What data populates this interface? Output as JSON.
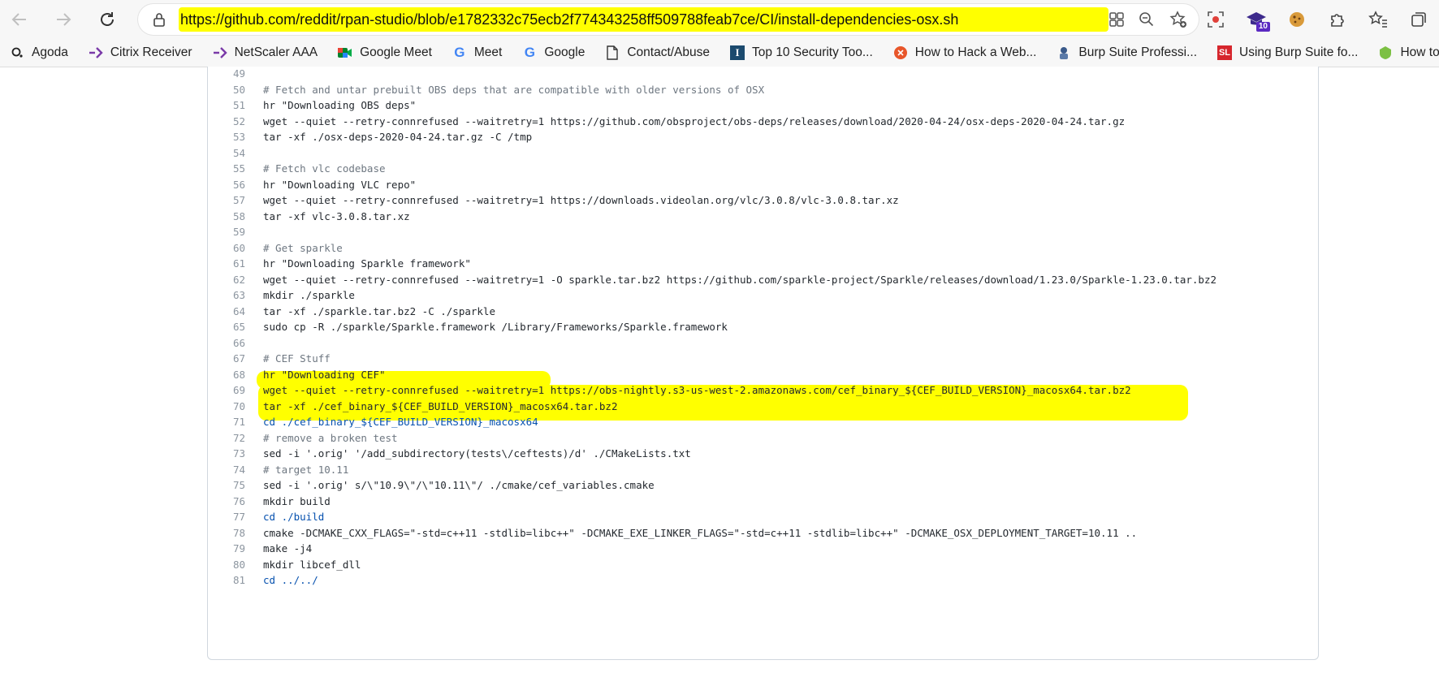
{
  "browser": {
    "url": "https://github.com/reddit/rpan-studio/blob/e1782332c75ecb2f774343258ff509788feab7ce/CI/install-dependencies-osx.sh",
    "extension_badge": "10",
    "colors": {
      "highlight": "#ffff00",
      "toolbar": "#f7f7f7"
    }
  },
  "bookmarks": [
    {
      "label": "Agoda",
      "icon": "agoda-icon"
    },
    {
      "label": "Citrix Receiver",
      "icon": "citrix-icon"
    },
    {
      "label": "NetScaler AAA",
      "icon": "netscaler-icon"
    },
    {
      "label": "Google Meet",
      "icon": "google-meet-icon"
    },
    {
      "label": "Meet",
      "icon": "google-icon"
    },
    {
      "label": "Google",
      "icon": "google-icon"
    },
    {
      "label": "Contact/Abuse",
      "icon": "document-icon"
    },
    {
      "label": "Top 10 Security Too...",
      "icon": "i-icon"
    },
    {
      "label": "How to Hack a Web...",
      "icon": "web-hack-icon"
    },
    {
      "label": "Burp Suite Professi...",
      "icon": "burp-icon"
    },
    {
      "label": "Using Burp Suite fo...",
      "icon": "sl-icon"
    },
    {
      "label": "How to Create a Pe",
      "icon": "shield-icon"
    }
  ],
  "code": {
    "lines": [
      {
        "n": "49",
        "text": "",
        "type": "plain"
      },
      {
        "n": "50",
        "text": "# Fetch and untar prebuilt OBS deps that are compatible with older versions of OSX",
        "type": "comment"
      },
      {
        "n": "51",
        "text": "hr \"Downloading OBS deps\"",
        "type": "plain"
      },
      {
        "n": "52",
        "text": "wget --quiet --retry-connrefused --waitretry=1 https://github.com/obsproject/obs-deps/releases/download/2020-04-24/osx-deps-2020-04-24.tar.gz",
        "type": "plain"
      },
      {
        "n": "53",
        "text": "tar -xf ./osx-deps-2020-04-24.tar.gz -C /tmp",
        "type": "plain"
      },
      {
        "n": "54",
        "text": "",
        "type": "plain"
      },
      {
        "n": "55",
        "text": "# Fetch vlc codebase",
        "type": "comment"
      },
      {
        "n": "56",
        "text": "hr \"Downloading VLC repo\"",
        "type": "plain"
      },
      {
        "n": "57",
        "text": "wget --quiet --retry-connrefused --waitretry=1 https://downloads.videolan.org/vlc/3.0.8/vlc-3.0.8.tar.xz",
        "type": "plain"
      },
      {
        "n": "58",
        "text": "tar -xf vlc-3.0.8.tar.xz",
        "type": "plain"
      },
      {
        "n": "59",
        "text": "",
        "type": "plain"
      },
      {
        "n": "60",
        "text": "# Get sparkle",
        "type": "comment"
      },
      {
        "n": "61",
        "text": "hr \"Downloading Sparkle framework\"",
        "type": "plain"
      },
      {
        "n": "62",
        "text": "wget --quiet --retry-connrefused --waitretry=1 -O sparkle.tar.bz2 https://github.com/sparkle-project/Sparkle/releases/download/1.23.0/Sparkle-1.23.0.tar.bz2",
        "type": "plain"
      },
      {
        "n": "63",
        "text": "mkdir ./sparkle",
        "type": "plain"
      },
      {
        "n": "64",
        "text": "tar -xf ./sparkle.tar.bz2 -C ./sparkle",
        "type": "plain"
      },
      {
        "n": "65",
        "text": "sudo cp -R ./sparkle/Sparkle.framework /Library/Frameworks/Sparkle.framework",
        "type": "plain"
      },
      {
        "n": "66",
        "text": "",
        "type": "plain"
      },
      {
        "n": "67",
        "text": "# CEF Stuff",
        "type": "comment"
      },
      {
        "n": "68",
        "text": "hr \"Downloading CEF\"",
        "type": "plain"
      },
      {
        "n": "69",
        "text": "wget --quiet --retry-connrefused --waitretry=1 https://obs-nightly.s3-us-west-2.amazonaws.com/cef_binary_${CEF_BUILD_VERSION}_macosx64.tar.bz2",
        "type": "plain"
      },
      {
        "n": "70",
        "text": "tar -xf ./cef_binary_${CEF_BUILD_VERSION}_macosx64.tar.bz2",
        "type": "plain"
      },
      {
        "n": "71",
        "text": "cd ./cef_binary_${CEF_BUILD_VERSION}_macosx64",
        "type": "kw"
      },
      {
        "n": "72",
        "text": "# remove a broken test",
        "type": "comment"
      },
      {
        "n": "73",
        "text": "sed -i '.orig' '/add_subdirectory(tests\\/ceftests)/d' ./CMakeLists.txt",
        "type": "plain"
      },
      {
        "n": "74",
        "text": "# target 10.11",
        "type": "comment"
      },
      {
        "n": "75",
        "text": "sed -i '.orig' s/\\\"10.9\\\"/\\\"10.11\\\"/ ./cmake/cef_variables.cmake",
        "type": "plain"
      },
      {
        "n": "76",
        "text": "mkdir build",
        "type": "plain"
      },
      {
        "n": "77",
        "text": "cd ./build",
        "type": "kw"
      },
      {
        "n": "78",
        "text": "cmake -DCMAKE_CXX_FLAGS=\"-std=c++11 -stdlib=libc++\" -DCMAKE_EXE_LINKER_FLAGS=\"-std=c++11 -stdlib=libc++\" -DCMAKE_OSX_DEPLOYMENT_TARGET=10.11 ..",
        "type": "plain"
      },
      {
        "n": "79",
        "text": "make -j4",
        "type": "plain"
      },
      {
        "n": "80",
        "text": "mkdir libcef_dll",
        "type": "plain"
      },
      {
        "n": "81",
        "text": "cd ../../",
        "type": "kw"
      }
    ]
  }
}
